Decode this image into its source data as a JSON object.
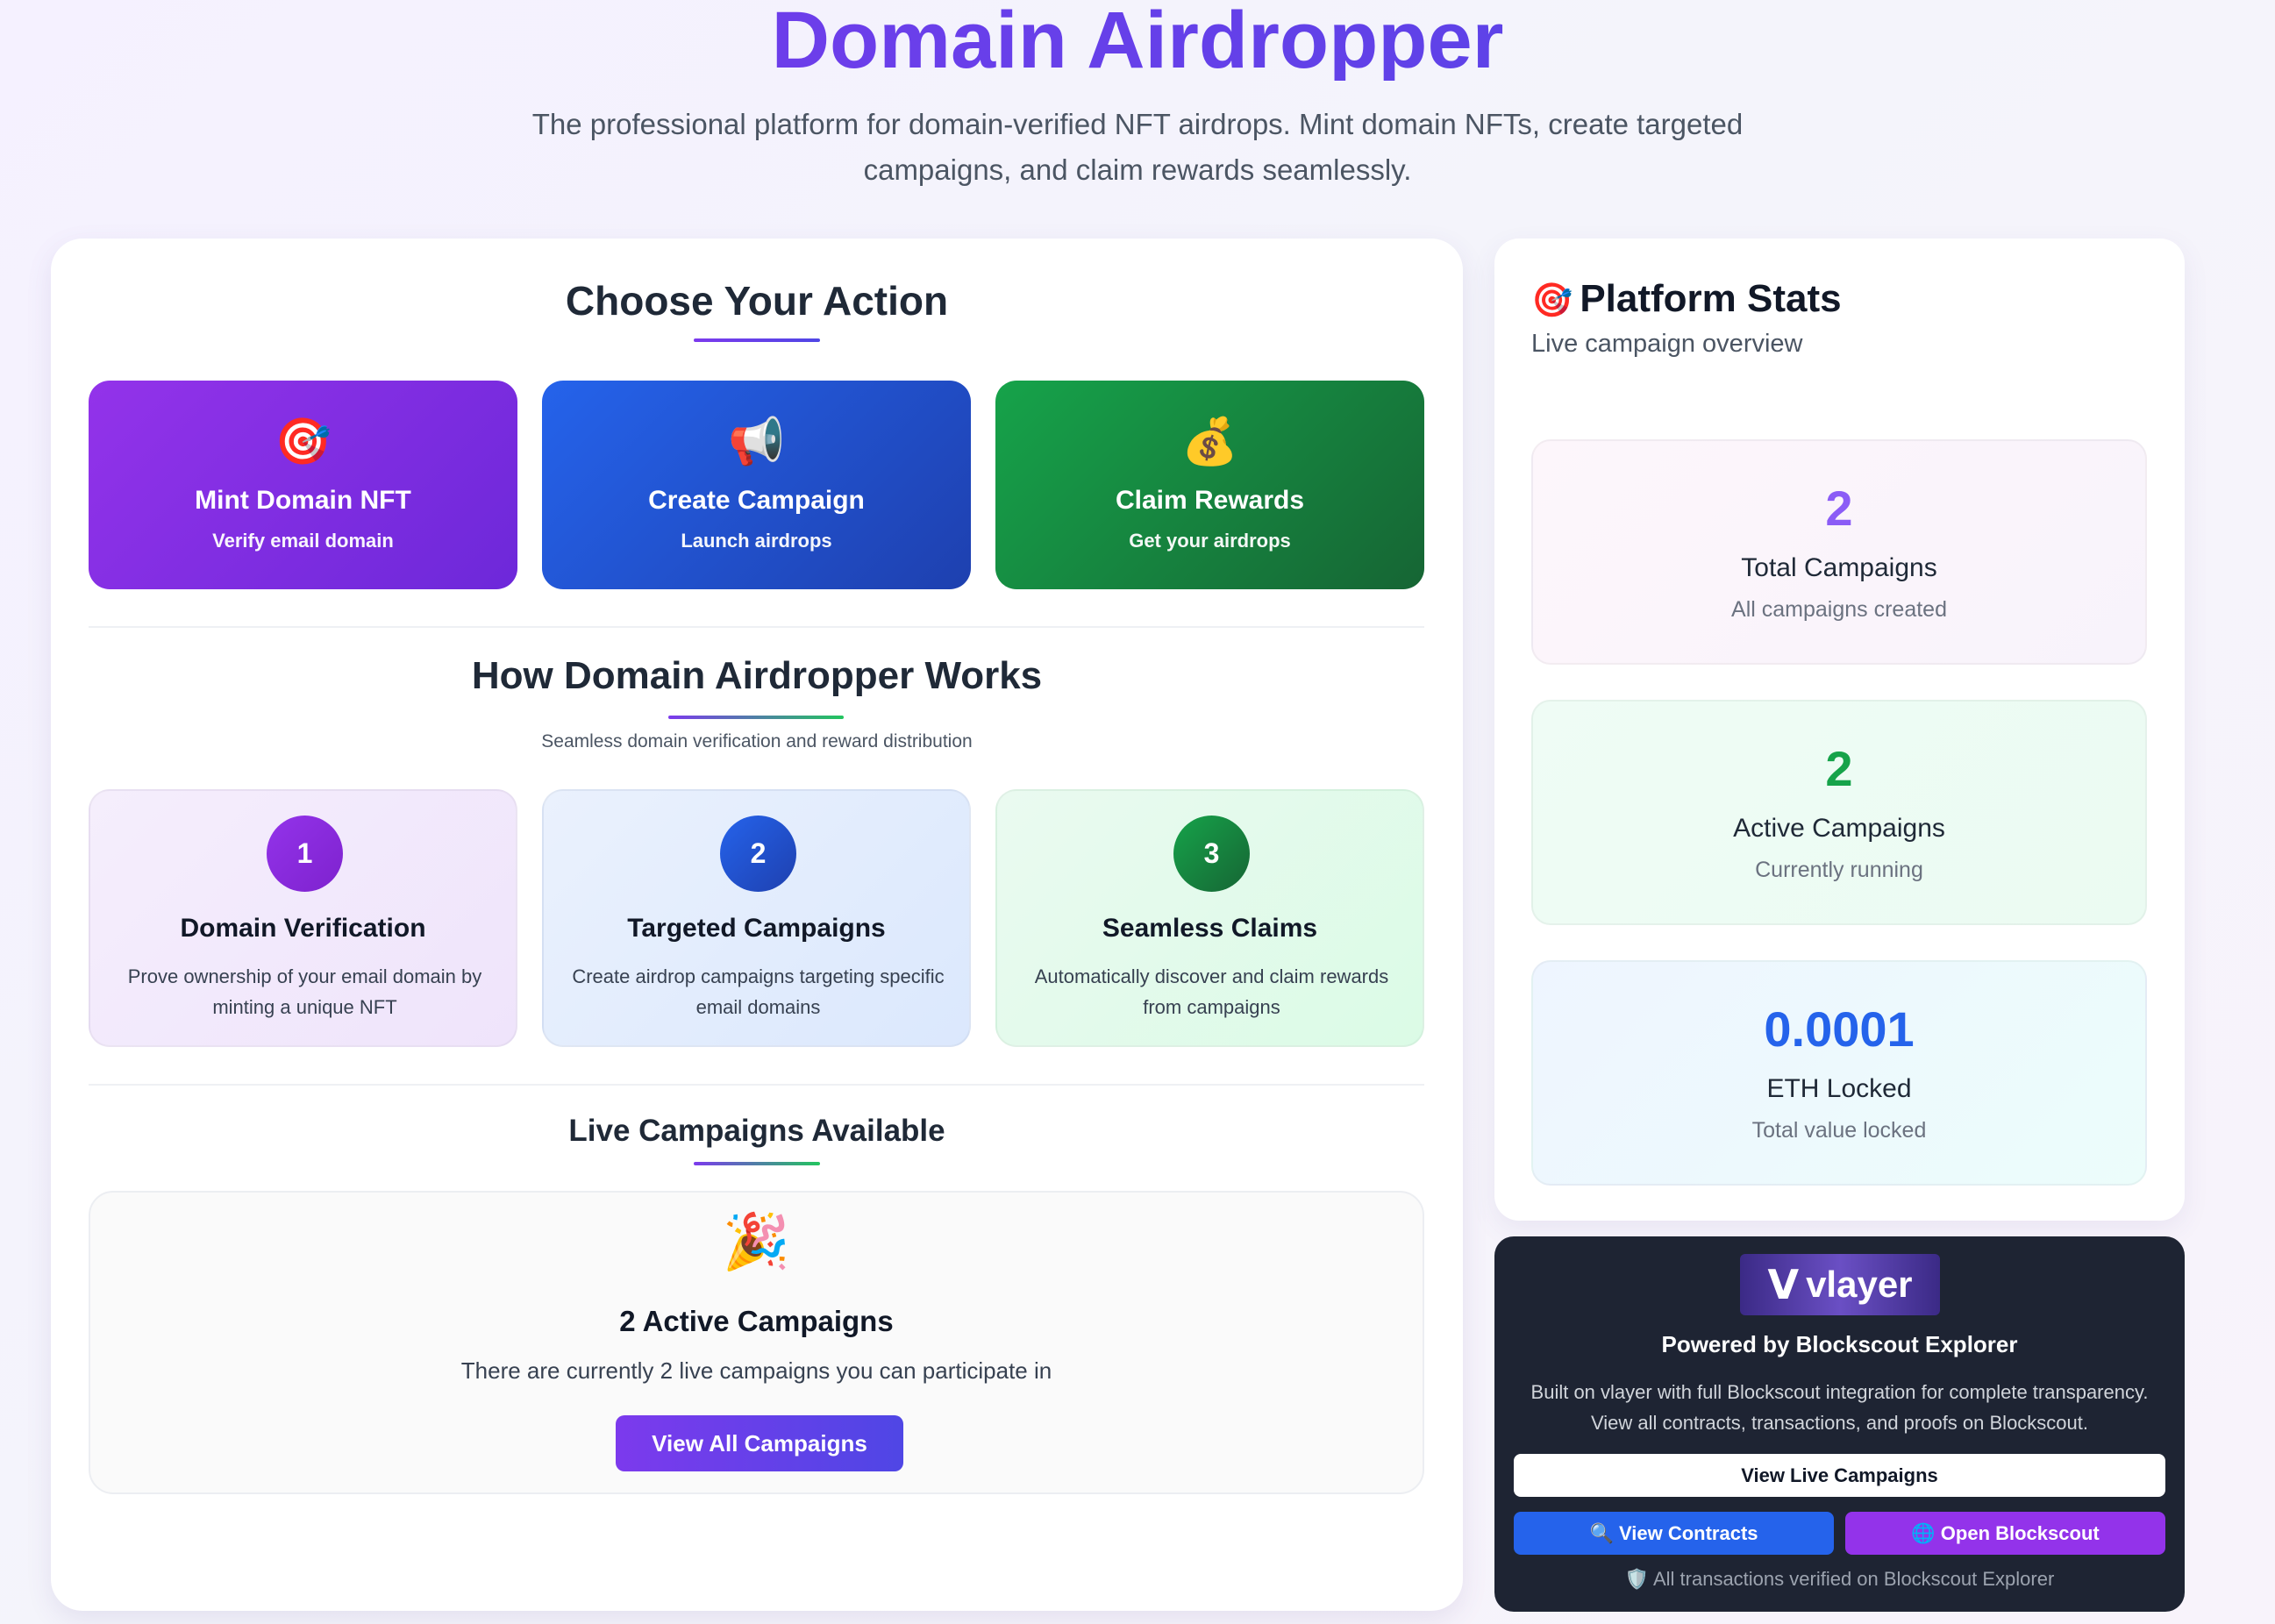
{
  "header": {
    "title": "Domain Airdropper",
    "subtitle": "The professional platform for domain-verified NFT airdrops. Mint domain NFTs, create targeted campaigns, and claim rewards seamlessly."
  },
  "actions": {
    "title": "Choose Your Action",
    "items": [
      {
        "icon": "🎯",
        "label": "Mint Domain NFT",
        "sub": "Verify email domain"
      },
      {
        "icon": "📢",
        "label": "Create Campaign",
        "sub": "Launch airdrops"
      },
      {
        "icon": "💰",
        "label": "Claim Rewards",
        "sub": "Get your airdrops"
      }
    ]
  },
  "how": {
    "title": "How Domain Airdropper Works",
    "subtitle": "Seamless domain verification and reward distribution",
    "steps": [
      {
        "num": "1",
        "title": "Domain Verification",
        "desc": "Prove ownership of your email domain by minting a unique NFT"
      },
      {
        "num": "2",
        "title": "Targeted Campaigns",
        "desc": "Create airdrop campaigns targeting specific email domains"
      },
      {
        "num": "3",
        "title": "Seamless Claims",
        "desc": "Automatically discover and claim rewards from campaigns"
      }
    ]
  },
  "live": {
    "title": "Live Campaigns Available",
    "icon": "🎉",
    "heading": "2 Active Campaigns",
    "desc": "There are currently 2 live campaigns you can participate in",
    "button": "View All Campaigns"
  },
  "stats": {
    "icon": "🎯",
    "title": "Platform Stats",
    "subtitle": "Live campaign overview",
    "items": [
      {
        "value": "2",
        "label": "Total Campaigns",
        "sub": "All campaigns created"
      },
      {
        "value": "2",
        "label": "Active Campaigns",
        "sub": "Currently running"
      },
      {
        "value": "0.0001",
        "label": "ETH Locked",
        "sub": "Total value locked"
      }
    ]
  },
  "vlayer": {
    "logo_mark": "V",
    "logo_word": "vlayer",
    "title": "Powered by Blockscout Explorer",
    "desc": "Built on vlayer with full Blockscout integration for complete transparency. View all contracts, transactions, and proofs on Blockscout.",
    "btn_live": "View Live Campaigns",
    "btn_contracts": "🔍 View Contracts",
    "btn_blockscout": "🌐 Open Blockscout",
    "footer": "🛡️ All transactions verified on Blockscout Explorer"
  },
  "colors": {
    "purple": "#7c3aed",
    "blue": "#2563eb",
    "green": "#16a34a",
    "dark_panel": "#1e2433"
  }
}
